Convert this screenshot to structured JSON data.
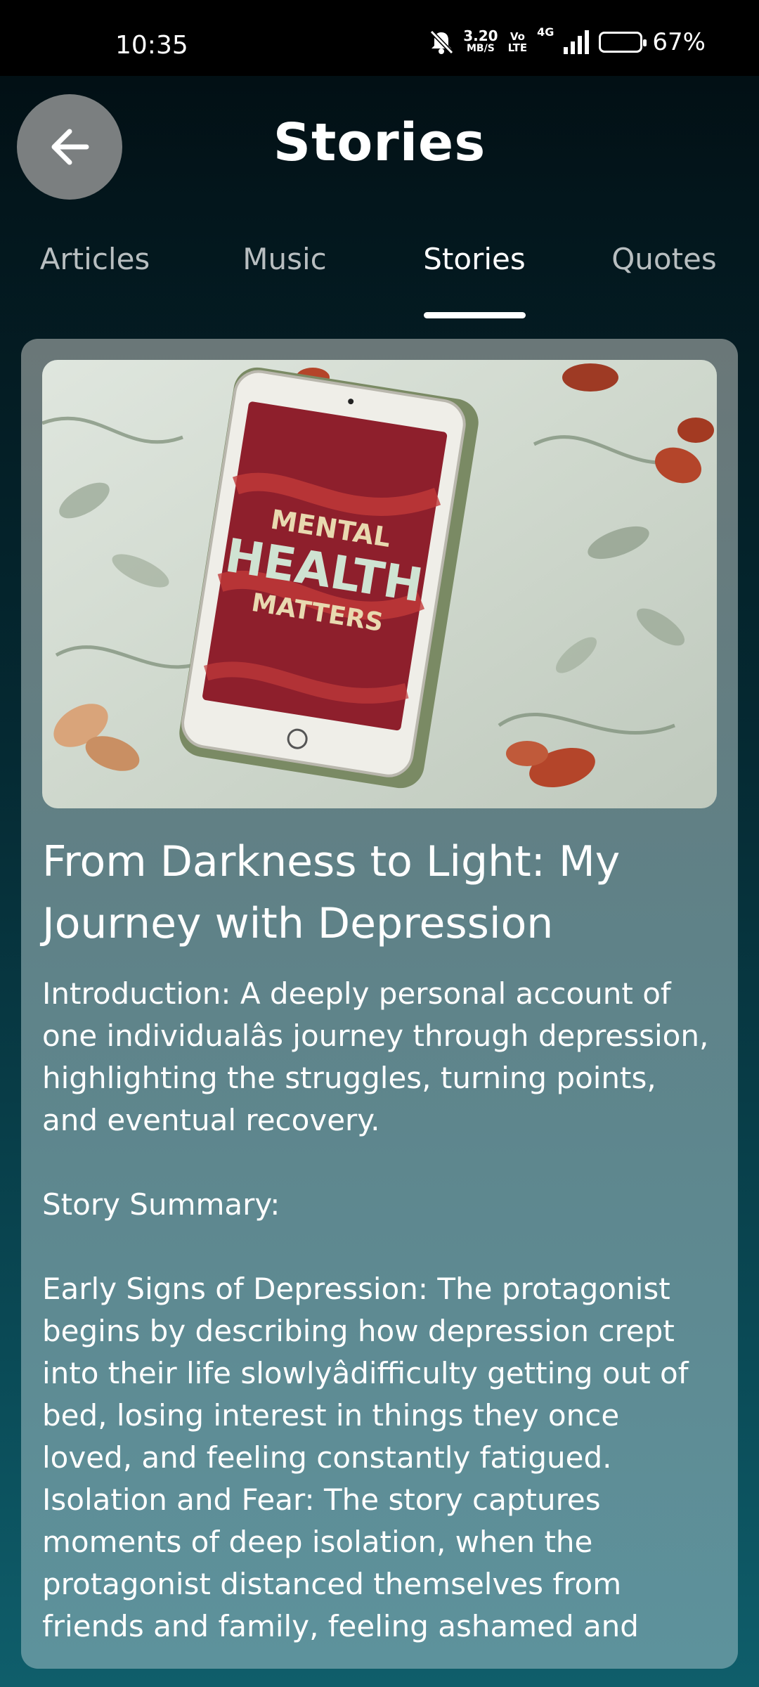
{
  "status_bar": {
    "time": "10:35",
    "net_speed_value": "3.20",
    "net_speed_unit": "MB/S",
    "volte_top": "Vo",
    "volte_bottom": "LTE",
    "network_type": "4G",
    "battery_percent": "67%",
    "battery_level": 0.67
  },
  "header": {
    "title": "Stories"
  },
  "tabs": [
    {
      "label": "Articles",
      "active": false
    },
    {
      "label": "Music",
      "active": false
    },
    {
      "label": "Stories",
      "active": true
    },
    {
      "label": "Quotes",
      "active": false
    }
  ],
  "story": {
    "image_text": [
      "MENTAL",
      "HEALTH",
      "MATTERS"
    ],
    "title": "From Darkness to Light: My Journey with Depression",
    "body": "Introduction: A deeply personal account of one individualâs journey through depression, highlighting the struggles, turning points, and eventual recovery.\n\nStory Summary:\n\nEarly Signs of Depression: The protagonist begins by describing how depression crept into their life slowlyâdifficulty getting out of bed, losing interest in things they once loved, and feeling constantly fatigued.\nIsolation and Fear: The story captures moments of deep isolation, when the protagonist distanced themselves from friends and family, feeling ashamed and"
  },
  "colors": {
    "accent": "#ffffff",
    "tab_inactive": "#b8bec0",
    "back_button": "#7b7f80",
    "tablet_screen": "#8e1f2c"
  }
}
